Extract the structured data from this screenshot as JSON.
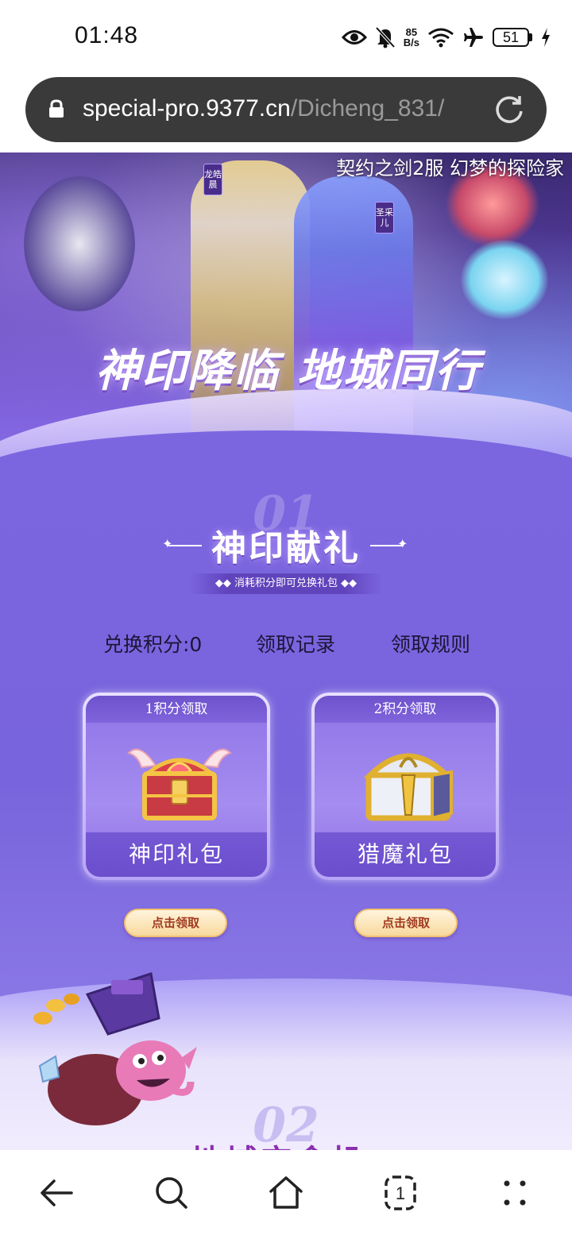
{
  "status_bar": {
    "time": "01:48",
    "net_speed_value": "85",
    "net_speed_unit": "B/s",
    "battery": "51",
    "icons": [
      "eye-icon",
      "bell-muted-icon",
      "wifi-icon",
      "airplane-icon",
      "battery-icon",
      "charging-icon"
    ]
  },
  "browser": {
    "url_domain": "special-pro.9377.cn",
    "url_path": "/Dicheng_831/",
    "icons": [
      "lock-icon",
      "reload-icon"
    ]
  },
  "hero": {
    "caption": "契约之剑2服 幻梦的探险家",
    "slogan": "神印降临 地城同行",
    "tag_left": "龙皓晨",
    "tag_right": "圣采儿"
  },
  "section1": {
    "number": "01",
    "title": "神印献礼",
    "subtitle": "◆◆ 消耗积分即可兑换礼包 ◆◆",
    "points_label": "兑换积分:0",
    "record_link": "领取记录",
    "rules_link": "领取规则",
    "gifts": [
      {
        "cost": "1积分领取",
        "name": "神印礼包",
        "button": "点击领取"
      },
      {
        "cost": "2积分领取",
        "name": "猎魔礼包",
        "button": "点击领取"
      }
    ]
  },
  "section2": {
    "number": "02",
    "title": "地城宝盒机"
  },
  "bottom_nav": {
    "tab_count": "1",
    "icons": [
      "back-arrow-icon",
      "search-icon",
      "home-icon",
      "tabs-icon",
      "menu-icon"
    ]
  },
  "colors": {
    "page_purple": "#7c66e0",
    "url_bar": "#3a3a3a",
    "button_gold": "#f8d99e",
    "button_text": "#a03a20"
  }
}
